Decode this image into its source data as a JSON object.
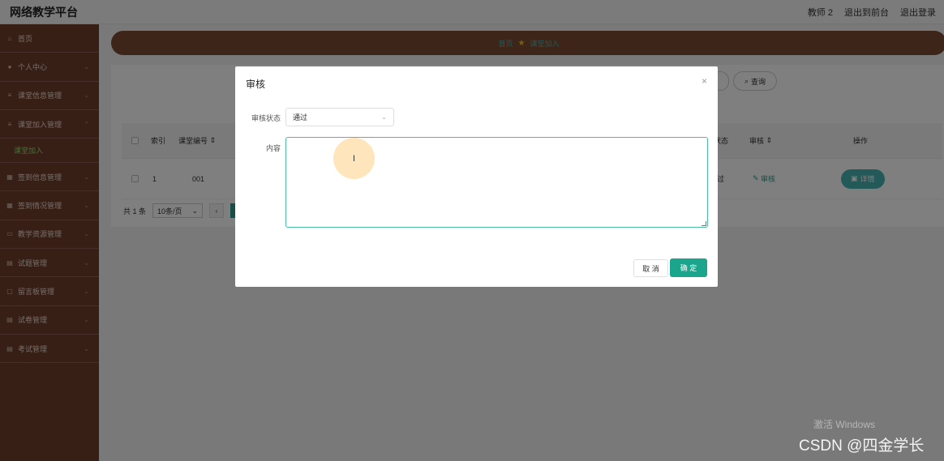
{
  "header": {
    "title": "网络教学平台",
    "user": "教师 2",
    "back_to_console": "退出到前台",
    "logout": "退出登录"
  },
  "sidebar": {
    "items": [
      {
        "label": "首页",
        "icon": "home-icon"
      },
      {
        "label": "个人中心",
        "icon": "user-icon"
      },
      {
        "label": "课堂信息管理",
        "icon": "list-icon"
      },
      {
        "label": "课堂加入管理",
        "icon": "list-icon"
      },
      {
        "label": "签到信息管理",
        "icon": "grid-icon"
      },
      {
        "label": "签到情况管理",
        "icon": "grid-icon"
      },
      {
        "label": "教学资源管理",
        "icon": "folder-icon"
      },
      {
        "label": "试题管理",
        "icon": "doc-icon"
      },
      {
        "label": "留言板管理",
        "icon": "message-icon"
      },
      {
        "label": "试卷管理",
        "icon": "doc-icon"
      },
      {
        "label": "考试管理",
        "icon": "doc-icon"
      }
    ],
    "active_sub": "课堂加入"
  },
  "breadcrumb": {
    "home": "首页",
    "current": "课堂加入"
  },
  "search": {
    "query_label": "查询"
  },
  "table": {
    "headers": [
      "索引",
      "课堂编号",
      "状态",
      "审核",
      "操作"
    ],
    "rows": [
      {
        "index": "1",
        "code": "001",
        "status": "过",
        "audit": "审核",
        "action": "详情"
      }
    ]
  },
  "pager": {
    "total": "共 1 条",
    "page_size": "10条/页"
  },
  "dialog": {
    "title": "审核",
    "status_label": "审核状态",
    "status_value": "通过",
    "content_label": "内容",
    "content_value": "",
    "cancel_label": "取 消",
    "ok_label": "确 定"
  },
  "watermarks": {
    "windows": "激活 Windows",
    "csdn": "CSDN @四金学长"
  },
  "colors": {
    "sidebar_bg": "#6e3f2b",
    "accent": "#1aa58c",
    "breadcrumb_bg": "#7a4a33"
  }
}
